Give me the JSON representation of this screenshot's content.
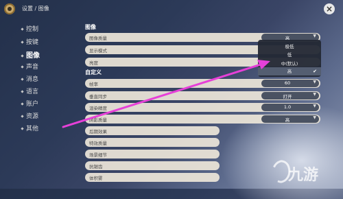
{
  "header": {
    "breadcrumb": "设置 / 图像"
  },
  "sidebar": {
    "items": [
      {
        "label": "控制"
      },
      {
        "label": "按键"
      },
      {
        "label": "图像"
      },
      {
        "label": "声音"
      },
      {
        "label": "消息"
      },
      {
        "label": "语言"
      },
      {
        "label": "账户"
      },
      {
        "label": "资源"
      },
      {
        "label": "其他"
      }
    ],
    "active": "图像"
  },
  "section_image": {
    "title": "图像",
    "rows": [
      {
        "label": "图像质量",
        "value": "高"
      },
      {
        "label": "显示模式",
        "value": ""
      },
      {
        "label": "亮度",
        "value": ""
      }
    ]
  },
  "section_custom": {
    "title": "自定义",
    "rows": [
      {
        "label": "帧率",
        "value": "60"
      },
      {
        "label": "垂直同步",
        "value": "打开"
      },
      {
        "label": "渲染精度",
        "value": "1.0"
      },
      {
        "label": "阴影质量",
        "value": "高"
      },
      {
        "label": "后期效果",
        "value": ""
      },
      {
        "label": "特效质量",
        "value": ""
      },
      {
        "label": "场景细节",
        "value": ""
      },
      {
        "label": "抗锯齿",
        "value": ""
      },
      {
        "label": "体积雾",
        "value": ""
      }
    ]
  },
  "dropdown": {
    "options": [
      {
        "label": "极低"
      },
      {
        "label": "低"
      },
      {
        "label": "中(默认)"
      },
      {
        "label": "高",
        "selected": true
      }
    ]
  },
  "watermark": {
    "text": "九游"
  },
  "colors": {
    "annotation_arrow": "#e640d8"
  }
}
